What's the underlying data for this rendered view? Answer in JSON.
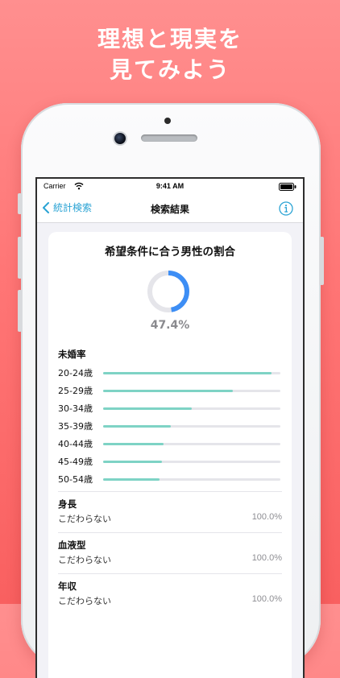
{
  "promo": {
    "headline_line1": "理想と現実を",
    "headline_line2": "見てみよう"
  },
  "status_bar": {
    "carrier": "Carrier",
    "time": "9:41 AM"
  },
  "nav": {
    "back_label": "統計検索",
    "title": "検索結果"
  },
  "result": {
    "title": "希望条件に合う男性の割合",
    "percent_text": "47.4%",
    "percent_value": 0.474,
    "ring_color": "#3d8ef5",
    "ring_track_color": "#e5e5ea"
  },
  "unmarried_rate": {
    "label": "未婚率",
    "bar_color": "#7ed3c5",
    "rows": [
      {
        "age": "20-24歳",
        "rate": 0.95
      },
      {
        "age": "25-29歳",
        "rate": 0.73
      },
      {
        "age": "30-34歳",
        "rate": 0.5
      },
      {
        "age": "35-39歳",
        "rate": 0.38
      },
      {
        "age": "40-44歳",
        "rate": 0.34
      },
      {
        "age": "45-49歳",
        "rate": 0.33
      },
      {
        "age": "50-54歳",
        "rate": 0.32
      }
    ]
  },
  "conditions": [
    {
      "label": "身長",
      "value": "こだわらない",
      "percent": "100.0%"
    },
    {
      "label": "血液型",
      "value": "こだわらない",
      "percent": "100.0%"
    },
    {
      "label": "年収",
      "value": "こだわらない",
      "percent": "100.0%"
    }
  ]
}
